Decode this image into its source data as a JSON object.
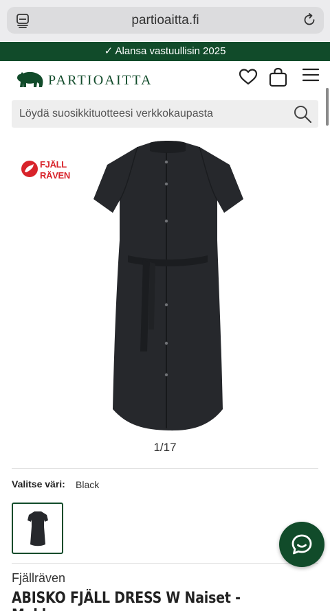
{
  "browser": {
    "url": "partioaitta.fi",
    "tabs_icon": "tabs-icon",
    "reload_icon": "reload-icon"
  },
  "promo": {
    "text": "✓ Alansa vastuullisin 2025"
  },
  "header": {
    "logo_text": "PARTIOAITTA",
    "icons": [
      "bear-logo-icon",
      "heart-icon",
      "shopping-bag-icon",
      "hamburger-menu-icon"
    ]
  },
  "search": {
    "placeholder": "Löydä suosikkituotteesi verkkokaupasta",
    "icon": "search-icon"
  },
  "product": {
    "brand_logo_text": "FJÄLL RÄVEN",
    "image_counter": "1/17",
    "color_label": "Valitse väri:",
    "color_value": "Black",
    "brand": "Fjällräven",
    "title": "ABISKO FJÄLL DRESS W Naiset - Mekko"
  },
  "colors": {
    "brand_green": "#114b2a",
    "fjallraven_red": "#d8232a",
    "dress": "#26282c"
  },
  "chat": {
    "icon": "chat-bubble-icon"
  }
}
